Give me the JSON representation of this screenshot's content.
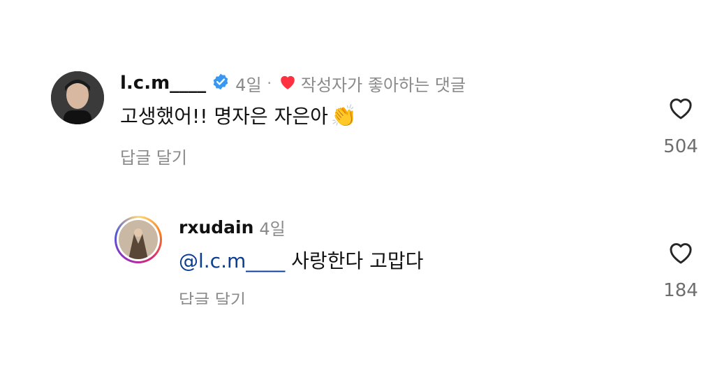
{
  "comments": [
    {
      "username": "l.c.m____",
      "time": "4일",
      "separator": "·",
      "liked_by_author": "작성자가 좋아하는 댓글",
      "text": "고생했어!! 명자은 자은아",
      "emoji": "👏",
      "reply_label": "답글 달기",
      "likes": "504",
      "verified": true
    },
    {
      "username": "rxudain",
      "time": "4일",
      "mention": "@l.c.m____",
      "text": " 사랑한다 고맙다",
      "reply_label": "답글 달기",
      "likes": "184",
      "has_story_ring": true
    }
  ],
  "colors": {
    "verified_blue": "#3897f0",
    "like_red": "#ff3040",
    "mention_blue": "#0b3d91",
    "secondary_text": "#8a8a8a"
  },
  "icons": {
    "verified": "verified-badge-icon",
    "liked": "heart-filled-icon",
    "like_button": "heart-outline-icon"
  }
}
